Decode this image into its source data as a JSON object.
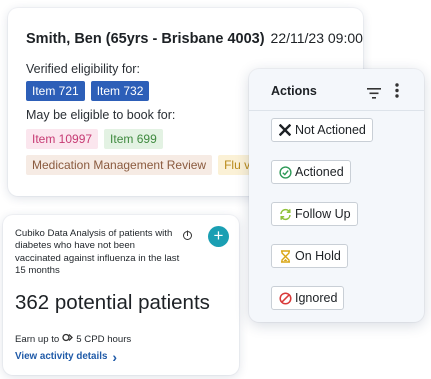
{
  "patient": {
    "name": "Smith, Ben (65yrs - Brisbane 4003)",
    "date": "22/11/23 09:00",
    "verified_label": "Verified eligibility for:",
    "verified_items": [
      "Item 721",
      "Item 732"
    ],
    "may_label": "May be eligible to book for:",
    "may_items": [
      "Item 10997",
      "Item 699"
    ],
    "more_items": [
      "Medication Management Review",
      "Flu v"
    ]
  },
  "cubiko": {
    "title": "Cubiko Data Analysis of patients with diabetes who have not been vaccinated against influenza in the last 15 months",
    "info_icon": "i",
    "plus_label": "+",
    "count": "362 potential patients",
    "cpd_prefix": "Earn up to",
    "cpd_value": "5 CPD hours",
    "view_link": "View activity details",
    "view_chevron": "›"
  },
  "actions": {
    "title": "Actions",
    "buttons": [
      {
        "label": "Not Actioned",
        "icon": "x-icon",
        "color": "#1d2125"
      },
      {
        "label": "Actioned",
        "icon": "check-circle-icon",
        "color": "#2f9a58"
      },
      {
        "label": "Follow Up",
        "icon": "refresh-icon",
        "color": "#8fc23a"
      },
      {
        "label": "On Hold",
        "icon": "hourglass-icon",
        "color": "#d9a514"
      },
      {
        "label": "Ignored",
        "icon": "ban-icon",
        "color": "#d93a3a"
      }
    ]
  },
  "colors": {
    "blue_tag": "#2d5fb8",
    "teal_accent": "#1a9fb3",
    "link": "#1f5aa8"
  }
}
